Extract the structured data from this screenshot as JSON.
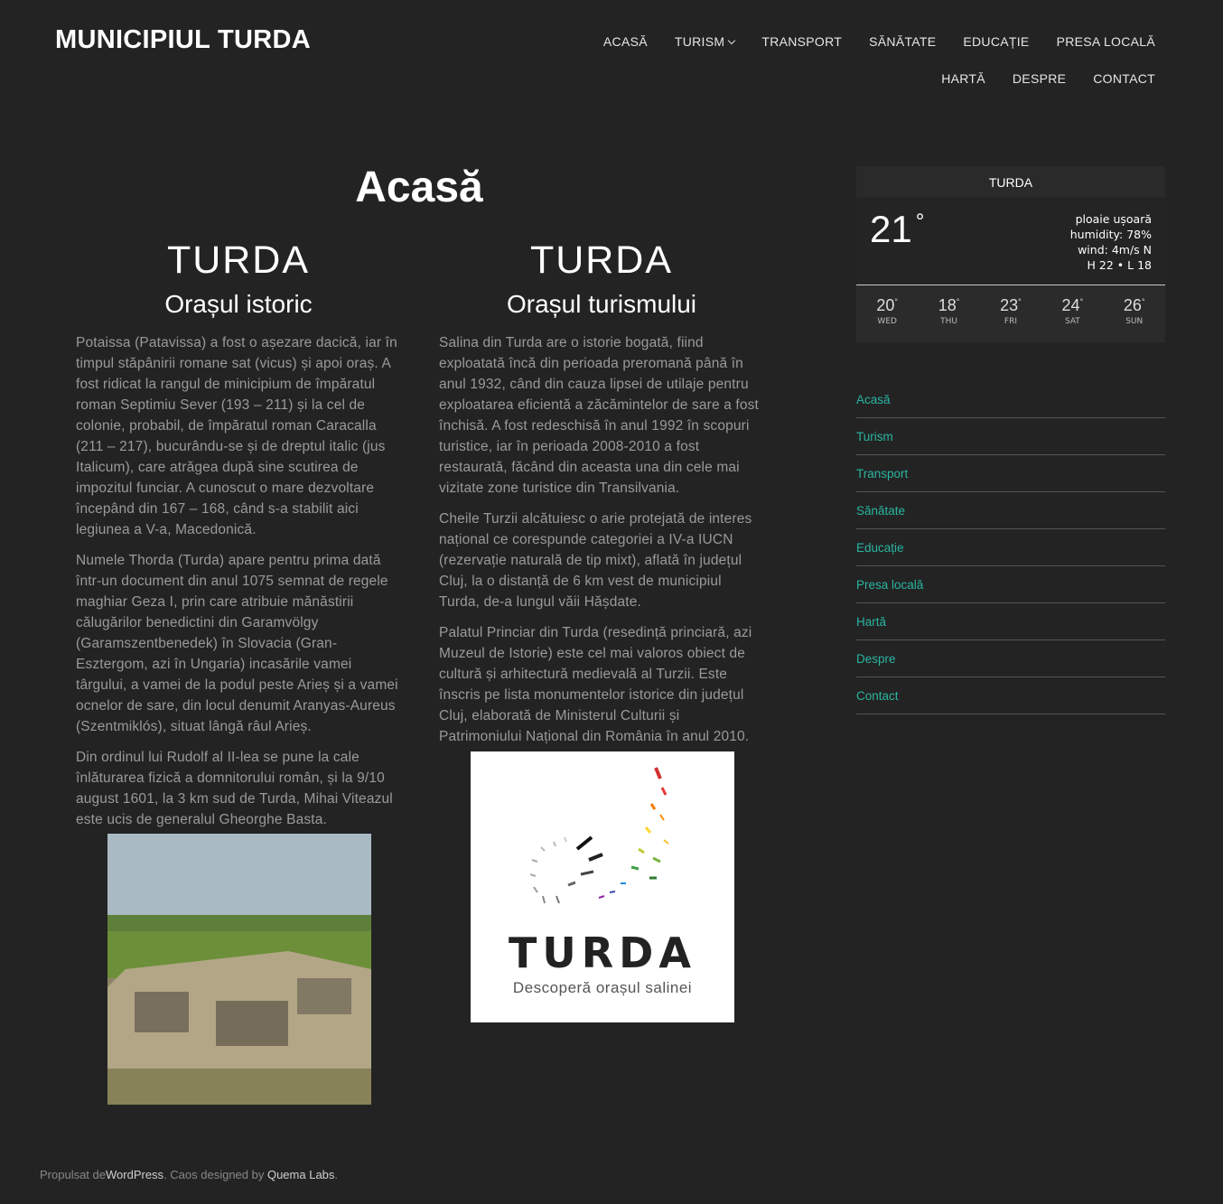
{
  "site": {
    "title": "MUNICIPIUL TURDA"
  },
  "nav": {
    "row1": [
      "ACASĂ",
      "TURISM",
      "TRANSPORT",
      "SĂNĂTATE",
      "EDUCAȚIE",
      "PRESA LOCALĂ"
    ],
    "row2": [
      "HARTĂ",
      "DESPRE",
      "CONTACT"
    ]
  },
  "main": {
    "title": "Acasă",
    "left": {
      "heading": "TURDA",
      "subheading": "Orașul istoric",
      "paragraphs": [
        "Potaissa (Patavissa) a fost o așezare dacică, iar în timpul stăpânirii romane sat (vicus) și apoi oraș. A fost ridicat la rangul de minicipium de împăratul roman Septimiu Sever (193 – 211) și la cel de colonie, probabil, de împăratul roman Caracalla (211 – 217), bucurându-se și de dreptul italic (jus Italicum), care atrăgea după sine scutirea de impozitul funciar. A cunoscut o mare dezvoltare începând din 167 – 168, când s-a stabilit aici legiunea a V-a, Macedonică.",
        "Numele Thorda (Turda) apare pentru prima dată într-un document din anul 1075 semnat de regele maghiar Geza I, prin care atribuie mănăstirii călugărilor benedictini din Garamvölgy (Garamszentbenedek) în Slovacia (Gran-Esztergom, azi în Ungaria) incasările vamei târgului, a vamei de la podul peste Arieș și a vamei ocnelor de sare, din locul denumit Aranyas-Aureus (Szentmiklós), situat lângă râul Arieș.",
        "Din ordinul lui Rudolf al II-lea se pune la cale înlăturarea fizică a domnitorului român, și la 9/10 august 1601, la 3 km sud de Turda, Mihai Viteazul este ucis de generalul Gheorghe Basta."
      ]
    },
    "right": {
      "heading": "TURDA",
      "subheading": "Orașul turismului",
      "paragraphs": [
        "Salina din Turda are o istorie bogată, fiind exploatată încă din perioada preromană până în anul 1932, când din cauza lipsei de utilaje pentru exploatarea eficientă a zăcămintelor de sare a fost închisă. A fost redeschisă în anul 1992 în scopuri turistice, iar în perioada 2008-2010 a fost restaurată, făcând din aceasta una din cele mai vizitate zone turistice din Transilvania.",
        "Cheile Turzii alcătuiesc o arie protejată de interes național ce corespunde categoriei a IV-a IUCN (rezervație naturală de tip mixt), aflată în județul Cluj, la o distanță de 6 km vest de municipiul Turda, de-a lungul văii Hășdate.",
        "Palatul Princiar din Turda (resedință princiară, azi Muzeul de Istorie) este cel mai valoros obiect de cultură și arhitectură medievală al Turzii. Este înscris pe lista monumentelor istorice din județul Cluj, elaborată de Ministerul Culturii și Patrimoniului Național din România în anul 2010."
      ],
      "logo": {
        "text": "TURDA",
        "tagline": "Descoperă orașul salinei"
      }
    }
  },
  "weather": {
    "city": "TURDA",
    "temp": "21",
    "deg": "°",
    "desc": "ploaie ușoară",
    "humidity": "humidity: 78%",
    "wind": "wind: 4m/s N",
    "hl": "H 22 • L 18",
    "forecast": [
      {
        "t": "20",
        "d": "WED"
      },
      {
        "t": "18",
        "d": "THU"
      },
      {
        "t": "23",
        "d": "FRI"
      },
      {
        "t": "24",
        "d": "SAT"
      },
      {
        "t": "26",
        "d": "SUN"
      }
    ]
  },
  "sidebar": {
    "items": [
      "Acasă",
      "Turism",
      "Transport",
      "Sănătate",
      "Educație",
      "Presa locală",
      "Hartă",
      "Despre",
      "Contact"
    ]
  },
  "footer": {
    "prefix": "Propulsat de",
    "wp": "WordPress",
    "mid": ". Caos designed by ",
    "author": "Quema Labs",
    "suffix": "."
  },
  "colors": {
    "background": "#232323",
    "accent": "#2ab5a0",
    "body_text": "#9a9a9a"
  }
}
